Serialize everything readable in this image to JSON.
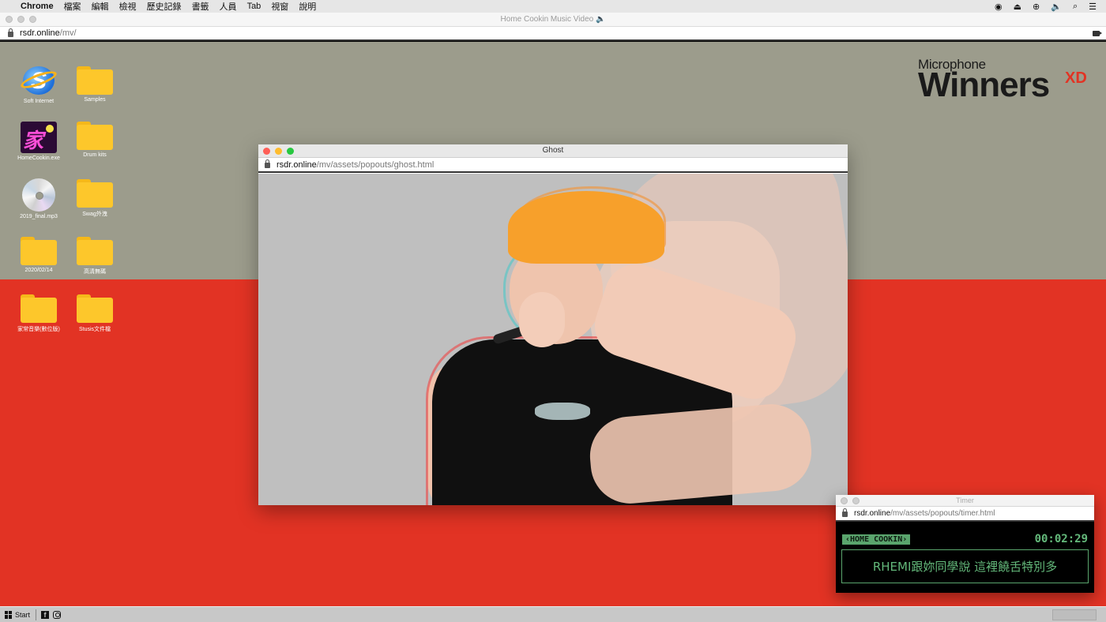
{
  "menubar": {
    "app": "Chrome",
    "items": [
      "檔案",
      "編輯",
      "檢視",
      "歷史記錄",
      "書籤",
      "人員",
      "Tab",
      "視窗",
      "說明"
    ]
  },
  "browser": {
    "window_title": "Home Cookin Music Video 🔈",
    "url_host": "rsdr.online",
    "url_path": "/mv/"
  },
  "logo": {
    "small": "Microphone",
    "big": "Winners",
    "suffix": "XD"
  },
  "desktop_icons": [
    {
      "label": "Soft Internet",
      "icon": "internet-icon"
    },
    {
      "label": "Samples",
      "icon": "folder-icon"
    },
    {
      "label": "HomeCookin.exe",
      "icon": "app-icon"
    },
    {
      "label": "Drum kits",
      "icon": "folder-icon"
    },
    {
      "label": "2019_final.mp3",
      "icon": "cd-icon"
    },
    {
      "label": "Swag外洩",
      "icon": "folder-icon"
    },
    {
      "label": "2020/02/14",
      "icon": "folder-icon"
    },
    {
      "label": "高清無碼",
      "icon": "folder-icon"
    },
    {
      "label": "家常音樂(數位版)",
      "icon": "folder-icon"
    },
    {
      "label": "Stusis文件檔",
      "icon": "folder-icon"
    }
  ],
  "ghost_window": {
    "title": "Ghost",
    "url_host": "rsdr.online",
    "url_path": "/mv/assets/popouts/ghost.html"
  },
  "timer_window": {
    "title": "Timer",
    "url_host": "rsdr.online",
    "url_path": "/mv/assets/popouts/timer.html",
    "tag": "‹HOME COOKIN›",
    "time": "00:02:29",
    "caption": "RHEMI跟妳同學說 這裡饒舌特別多"
  },
  "taskbar": {
    "start_label": "Start",
    "facebook_glyph": "f"
  },
  "colors": {
    "desktop_top": "#9c9c8c",
    "desktop_bottom": "#e23324",
    "timer_green": "#63b87a"
  }
}
